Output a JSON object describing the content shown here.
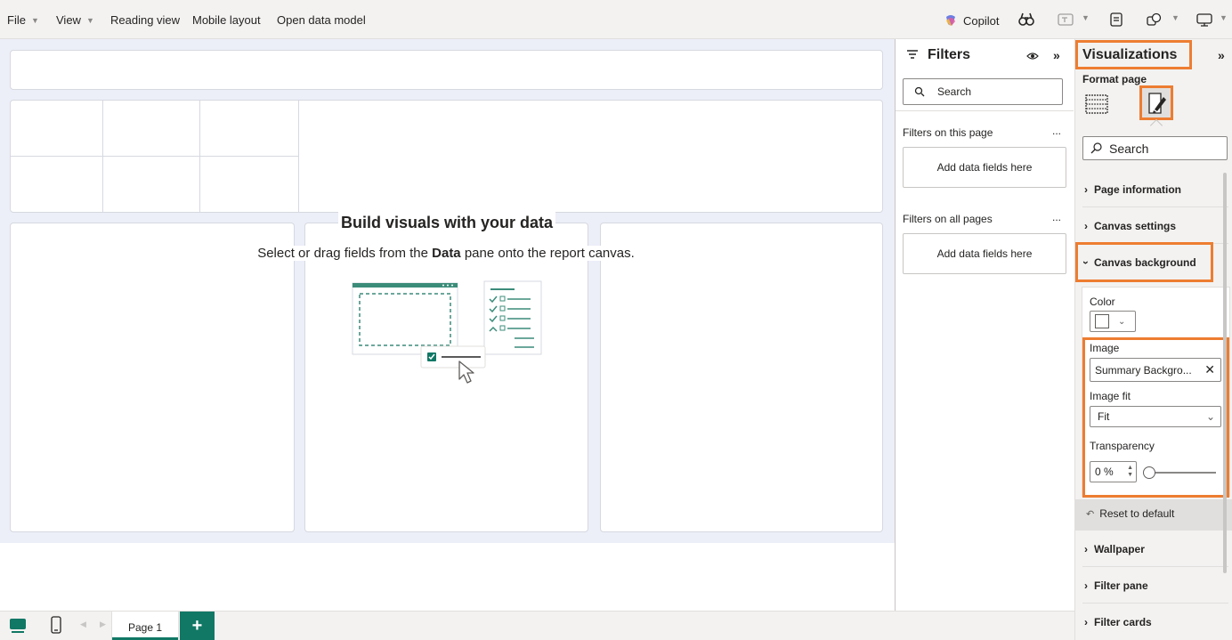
{
  "menu": {
    "file": "File",
    "view": "View",
    "reading_view": "Reading view",
    "mobile_layout": "Mobile layout",
    "open_data_model": "Open data model",
    "copilot": "Copilot"
  },
  "canvas": {
    "empty_title": "Build visuals with your data",
    "empty_subtitle_pre": "Select or drag fields from the ",
    "empty_subtitle_bold": "Data",
    "empty_subtitle_post": " pane onto the report canvas."
  },
  "filters": {
    "title": "Filters",
    "search_placeholder": "Search",
    "this_page_label": "Filters on this page",
    "this_page_add": "Add data fields here",
    "all_pages_label": "Filters on all pages",
    "all_pages_add": "Add data fields here",
    "more": "..."
  },
  "visualizations": {
    "title": "Visualizations",
    "format_page": "Format page",
    "search_placeholder": "Search",
    "sections": {
      "page_information": "Page information",
      "canvas_settings": "Canvas settings",
      "canvas_background": "Canvas background",
      "wallpaper": "Wallpaper",
      "filter_pane": "Filter pane",
      "filter_cards": "Filter cards"
    },
    "canvas_background": {
      "color_label": "Color",
      "color_value": "#ffffff",
      "image_label": "Image",
      "image_value": "Summary Backgro...",
      "image_fit_label": "Image fit",
      "image_fit_value": "Fit",
      "transparency_label": "Transparency",
      "transparency_value": "0 %",
      "transparency_level": 0,
      "reset": "Reset to default"
    }
  },
  "pages": {
    "tabs": [
      "Page 1"
    ],
    "add_label": "+"
  },
  "colors": {
    "accent_green": "#117865",
    "highlight_orange": "#ed7d31"
  }
}
